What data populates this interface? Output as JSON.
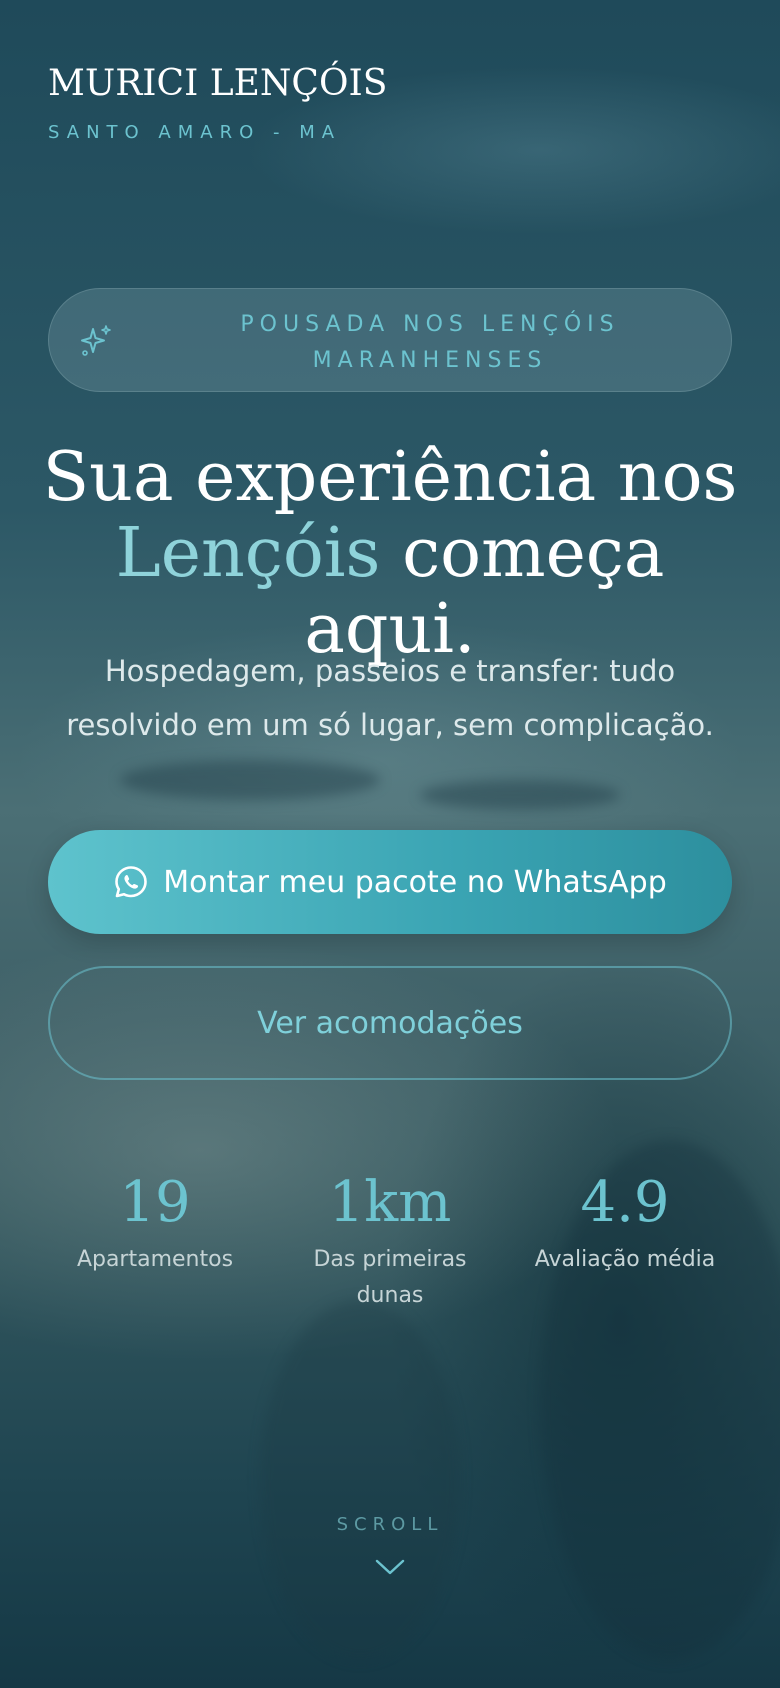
{
  "brand": {
    "title": "MURICI LENÇÓIS",
    "subtitle": "SANTO AMARO - MA"
  },
  "badge": {
    "icon": "sparkles-icon",
    "text": "POUSADA NOS LENÇÓIS MARANHENSES"
  },
  "hero": {
    "headline_part1": "Sua experiência nos",
    "headline_accent": "Lençóis",
    "headline_part2": "começa aqui.",
    "subtext": "Hospedagem, passeios e transfer: tudo resolvido em um só lugar, sem complicação."
  },
  "cta": {
    "primary_icon": "whatsapp-icon",
    "primary_label": "Montar meu pacote no WhatsApp",
    "secondary_label": "Ver acomodações"
  },
  "stats": [
    {
      "value": "19",
      "label": "Apartamentos"
    },
    {
      "value": "1km",
      "label": "Das primeiras dunas"
    },
    {
      "value": "4.9",
      "label": "Avaliação média"
    }
  ],
  "scroll": {
    "label": "SCROLL",
    "icon": "chevron-down-icon"
  },
  "colors": {
    "accent": "#6cc3cf",
    "accent_light": "#8fd3da",
    "button_gradient_start": "#5ec3cd",
    "button_gradient_end": "#2d8f9e"
  }
}
